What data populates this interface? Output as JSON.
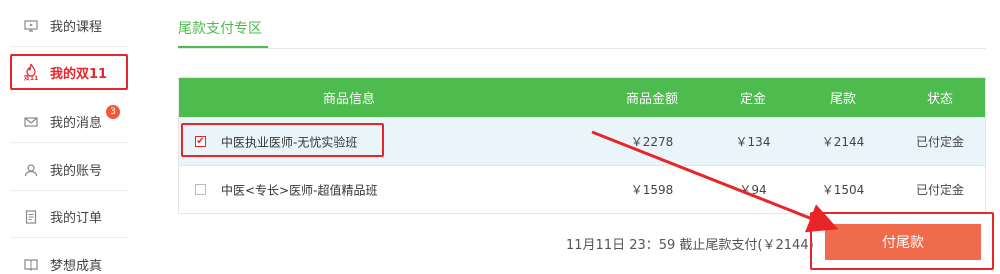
{
  "sidebar": {
    "items": [
      {
        "label": "我的课程",
        "icon": "monitor-icon"
      },
      {
        "label": "我的双11",
        "icon": "flame-11-icon"
      },
      {
        "label": "我的消息",
        "icon": "mail-icon",
        "badge": "3"
      },
      {
        "label": "我的账号",
        "icon": "user-icon"
      },
      {
        "label": "我的订单",
        "icon": "document-icon"
      },
      {
        "label": "梦想成真",
        "icon": "book-icon"
      }
    ]
  },
  "main": {
    "tab_label": "尾款支付专区",
    "table": {
      "headers": {
        "info": "商品信息",
        "amount": "商品金额",
        "deposit": "定金",
        "balance": "尾款",
        "status": "状态"
      },
      "rows": [
        {
          "name": "中医执业医师-无忧实验班",
          "amount": "￥2278",
          "deposit": "￥134",
          "balance": "￥2144",
          "status": "已付定金",
          "checked": true
        },
        {
          "name": "中医<专长>医师-超值精品班",
          "amount": "￥1598",
          "deposit": "￥94",
          "balance": "￥1504",
          "status": "已付定金",
          "checked": false
        }
      ]
    },
    "deadline_text": "11月11日 23：59 截止尾款支付(￥2144)",
    "pay_button": "付尾款"
  },
  "colors": {
    "green": "#4dbb4d",
    "red": "#e8262a",
    "orange": "#f06a4c"
  }
}
